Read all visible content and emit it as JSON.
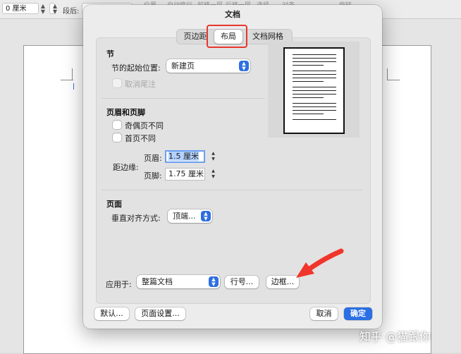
{
  "background": {
    "toolbar": {
      "indent_value": "0 厘米",
      "spacing_after_label": "段后:",
      "faded_labels": [
        "位置",
        "自动换行",
        "前移一层",
        "后移一层",
        "选择",
        "对齐",
        "",
        "旋转"
      ]
    }
  },
  "dialog": {
    "title": "文档",
    "tabs": [
      {
        "label": "页边距",
        "active": false
      },
      {
        "label": "布局",
        "active": true
      },
      {
        "label": "文档网格",
        "active": false
      }
    ],
    "section": {
      "heading": "节",
      "start_label": "节的起始位置:",
      "start_value": "新建页",
      "suppress_endnotes_label": "取消尾注"
    },
    "headers_footers": {
      "heading": "页眉和页脚",
      "odd_even_label": "奇偶页不同",
      "first_page_label": "首页不同",
      "from_edge_label": "距边缘:",
      "header_label": "页眉:",
      "header_value": "1.5 厘米",
      "footer_label": "页脚:",
      "footer_value": "1.75 厘米"
    },
    "page": {
      "heading": "页面",
      "vertical_align_label": "垂直对齐方式:",
      "vertical_align_value": "顶端..."
    },
    "apply_to_label": "应用于:",
    "apply_to_value": "整篇文档",
    "line_numbers_button": "行号...",
    "borders_button": "边框...",
    "default_button": "默认...",
    "page_setup_button": "页面设置...",
    "cancel_button": "取消",
    "ok_button": "确定",
    "accent_color": "#2a6fe3",
    "highlight_color": "#e8362f",
    "annotation_arrow_color": "#f0352a"
  },
  "watermark": "知乎 @猫跟你"
}
